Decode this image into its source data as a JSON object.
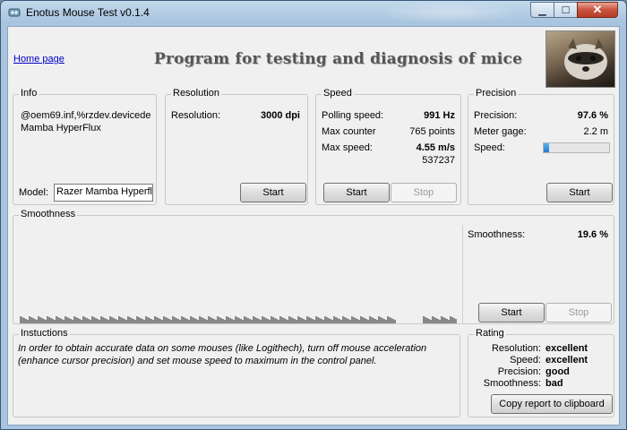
{
  "window": {
    "title": "Enotus Mouse Test v0.1.4"
  },
  "header": {
    "home_link": "Home page",
    "heading": "Program for testing and diagnosis of mice"
  },
  "info": {
    "title": "Info",
    "line1": "@oem69.inf,%rzdev.devicede",
    "line2": "Mamba HyperFlux",
    "model_label": "Model:",
    "model_value": "Razer Mamba Hyperflu"
  },
  "resolution": {
    "title": "Resolution",
    "label": "Resolution:",
    "value": "3000 dpi",
    "start_label": "Start"
  },
  "speed": {
    "title": "Speed",
    "polling_label": "Polling speed:",
    "polling_value": "991 Hz",
    "max_counter_label": "Max counter",
    "max_counter_value": "765 points",
    "max_speed_label": "Max  speed:",
    "max_speed_value": "4.55 m/s",
    "max_speed_sub": "537237",
    "start_label": "Start",
    "stop_label": "Stop"
  },
  "precision": {
    "title": "Precision",
    "precision_label": "Precision:",
    "precision_value": "97.6 %",
    "meter_label": "Meter gage:",
    "meter_value": "2.2 m",
    "speed_label": "Speed:",
    "speed_level": 0.08,
    "start_label": "Start"
  },
  "smoothness": {
    "title": "Smoothness",
    "label": "Smoothness:",
    "value": "19.6 %",
    "start_label": "Start",
    "stop_label": "Stop"
  },
  "instructions": {
    "title": "Instuctions",
    "text": "In order to obtain accurate data on some mouses (like Logithech), turn off mouse acceleration (enhance cursor precision) and set mouse speed to maximum in the control panel."
  },
  "rating": {
    "title": "Rating",
    "rows": [
      {
        "key": "Resolution:",
        "value": "excellent"
      },
      {
        "key": "Speed:",
        "value": "excellent"
      },
      {
        "key": "Precision:",
        "value": "good"
      },
      {
        "key": "Smoothness:",
        "value": "bad"
      }
    ],
    "copy_label": "Copy report to clipboard"
  }
}
